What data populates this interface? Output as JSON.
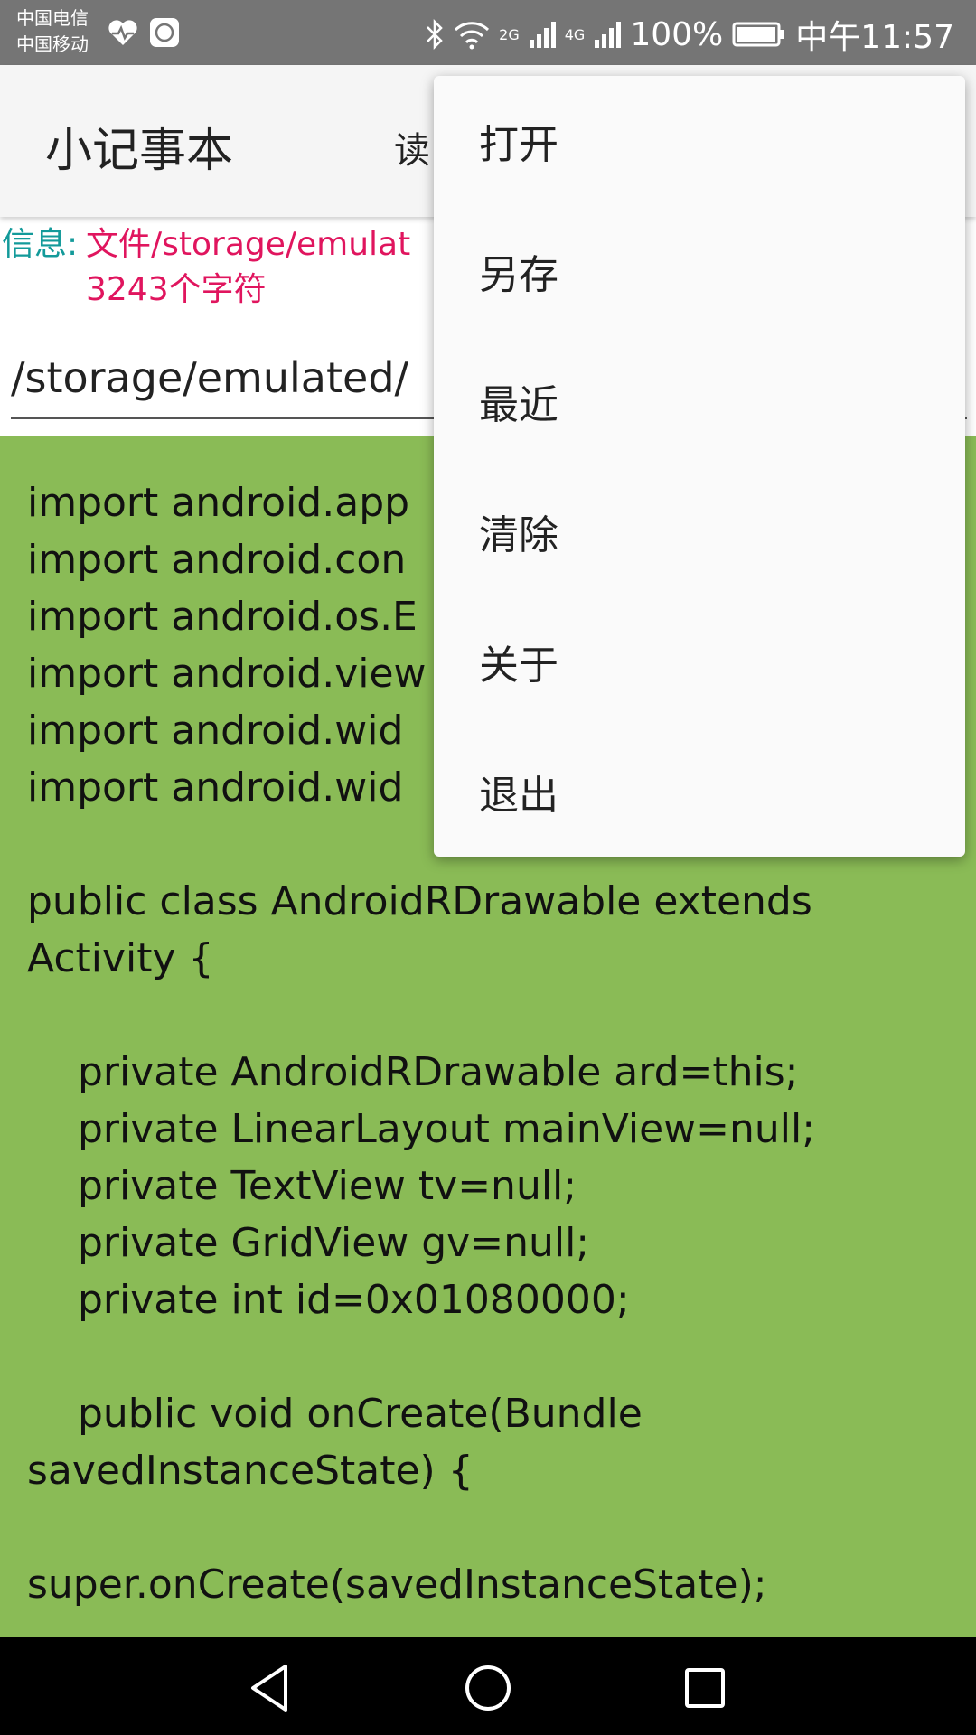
{
  "status_bar": {
    "carrier_1": "中国电信",
    "carrier_2": "中国移动",
    "signal_2g": "2G",
    "signal_4g": "4G",
    "battery": "100%",
    "time": "中午11:57",
    "icons": [
      "heart-rate-icon",
      "mi-icon",
      "bluetooth-icon",
      "wifi-icon",
      "signal-icon",
      "battery-icon"
    ]
  },
  "action_bar": {
    "title": "小记事本",
    "read_action": "读"
  },
  "info": {
    "label": "信息:",
    "text": "文件/storage/emulat",
    "text_line2": "3243个字符"
  },
  "path_field": {
    "value": "/storage/emulated/"
  },
  "editor": {
    "content": "import android.app\nimport android.con\nimport android.os.E\nimport android.view\nimport android.wid\nimport android.wid\n\npublic class AndroidRDrawable extends Activity {\n\n    private AndroidRDrawable ard=this;\n    private LinearLayout mainView=null;\n    private TextView tv=null;\n    private GridView gv=null;\n    private int id=0x01080000;\n\n    public void onCreate(Bundle savedInstanceState) {\n\nsuper.onCreate(savedInstanceState);",
    "background": "#8abb56"
  },
  "menu": {
    "items": [
      {
        "label": "打开"
      },
      {
        "label": "另存"
      },
      {
        "label": "最近"
      },
      {
        "label": "清除"
      },
      {
        "label": "关于"
      },
      {
        "label": "退出"
      }
    ]
  },
  "nav_bar": {
    "icons": [
      "back-icon",
      "home-icon",
      "recents-icon"
    ]
  },
  "colors": {
    "status_bar": "#757575",
    "info_label": "#139a9a",
    "info_text": "#e0155e",
    "editor_bg": "#8abb56"
  }
}
